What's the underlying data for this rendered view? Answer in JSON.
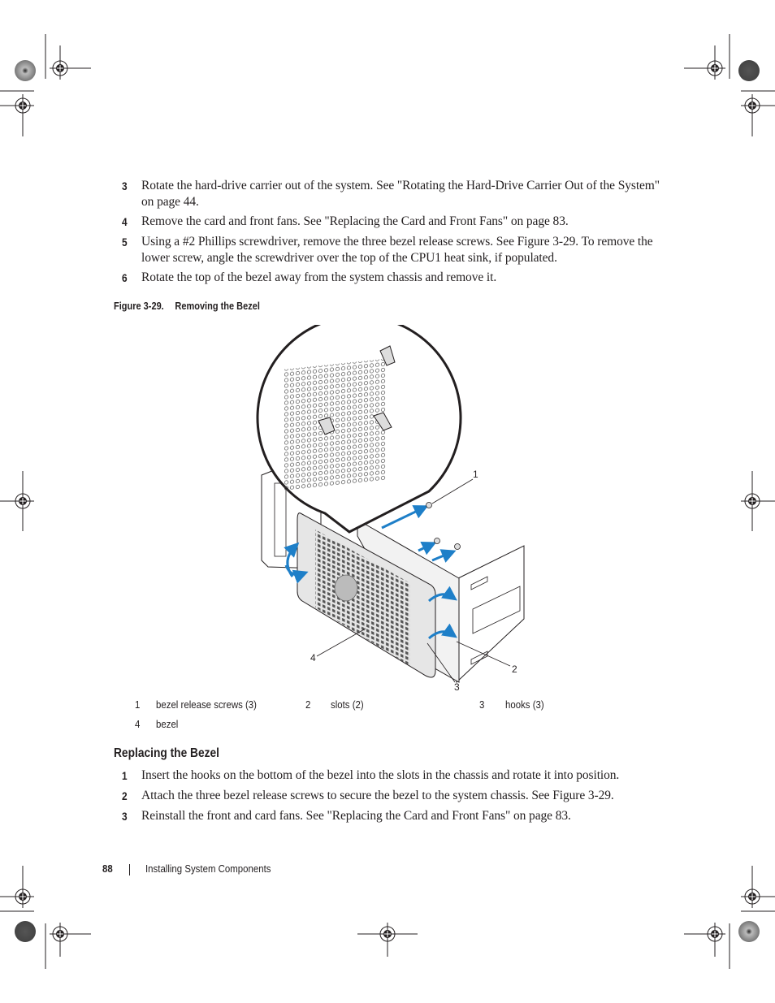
{
  "steps_top": [
    {
      "num": "3",
      "text": "Rotate the hard-drive carrier out of the system. See \"Rotating the Hard-Drive Carrier Out of the System\" on page 44."
    },
    {
      "num": "4",
      "text": "Remove the card and front fans. See \"Replacing the Card and Front Fans\" on page 83."
    },
    {
      "num": "5",
      "text": "Using a #2 Phillips screwdriver, remove the three bezel release screws. See Figure 3-29. To remove the lower screw, angle the screwdriver over the top of the CPU1 heat sink, if populated."
    },
    {
      "num": "6",
      "text": "Rotate the top of the bezel away from the system chassis and remove it."
    }
  ],
  "figure": {
    "label": "Figure 3-29.",
    "title": "Removing the Bezel",
    "callouts": [
      "1",
      "2",
      "3",
      "4"
    ],
    "arrow_color": "#1e7fc8",
    "legend": [
      {
        "num": "1",
        "text": "bezel release screws (3)"
      },
      {
        "num": "2",
        "text": "slots (2)"
      },
      {
        "num": "3",
        "text": "hooks (3)"
      },
      {
        "num": "4",
        "text": "bezel"
      }
    ]
  },
  "section": {
    "heading": "Replacing the Bezel",
    "steps": [
      {
        "num": "1",
        "text": "Insert the hooks on the bottom of the bezel into the slots in the chassis and rotate it into position."
      },
      {
        "num": "2",
        "text": "Attach the three bezel release screws to secure the bezel to the system chassis. See Figure 3-29."
      },
      {
        "num": "3",
        "text": "Reinstall the front and card fans. See \"Replacing the Card and Front Fans\" on page 83."
      }
    ]
  },
  "footer": {
    "page_number": "88",
    "section_title": "Installing System Components"
  }
}
